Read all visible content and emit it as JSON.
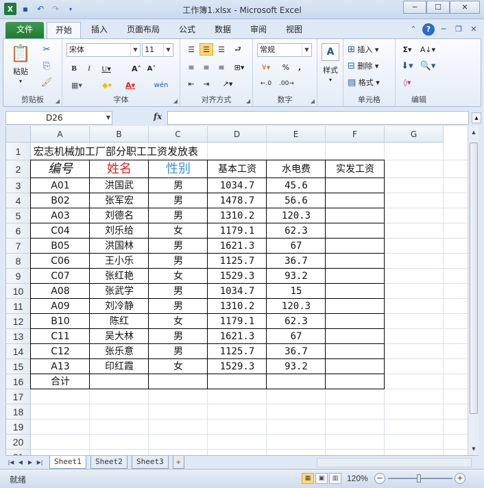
{
  "window": {
    "title": "工作簿1.xlsx  -  Microsoft Excel",
    "min_label": "─",
    "max_label": "☐",
    "close_label": "✕"
  },
  "ribbon_tabs": [
    "文件",
    "开始",
    "插入",
    "页面布局",
    "公式",
    "数据",
    "审阅",
    "视图"
  ],
  "ribbon": {
    "clipboard": {
      "label": "剪贴板",
      "paste": "粘贴"
    },
    "font": {
      "label": "字体",
      "font_name": "宋体",
      "font_size": "11"
    },
    "alignment": {
      "label": "对齐方式"
    },
    "number": {
      "label": "数字",
      "format": "常规"
    },
    "styles": {
      "label": "样式"
    },
    "cells": {
      "label": "单元格",
      "insert": "插入",
      "delete": "删除",
      "format": "格式"
    },
    "editing": {
      "label": "编辑"
    }
  },
  "formula_bar": {
    "name_box": "D26",
    "fx": "fx",
    "value": ""
  },
  "columns": [
    "A",
    "B",
    "C",
    "D",
    "E",
    "F",
    "G"
  ],
  "rows": [
    "1",
    "2",
    "3",
    "4",
    "5",
    "6",
    "7",
    "8",
    "9",
    "10",
    "11",
    "12",
    "13",
    "14",
    "15",
    "16",
    "17",
    "18",
    "19",
    "20",
    "21"
  ],
  "sheet": {
    "title": "宏志机械加工厂部分职工工资发放表",
    "headers": [
      "编号",
      "姓名",
      "性别",
      "基本工资",
      "水电费",
      "实发工资"
    ],
    "header_colors": [
      "#111111",
      "#e0201a",
      "#3b8fd8",
      "#111111",
      "#111111",
      "#111111"
    ],
    "records": [
      [
        "A01",
        "洪国武",
        "男",
        "1034.7",
        "45.6"
      ],
      [
        "B02",
        "张军宏",
        "男",
        "1478.7",
        "56.6"
      ],
      [
        "A03",
        "刘德名",
        "男",
        "1310.2",
        "120.3"
      ],
      [
        "C04",
        "刘乐给",
        "女",
        "1179.1",
        "62.3"
      ],
      [
        "B05",
        "洪国林",
        "男",
        "1621.3",
        "67"
      ],
      [
        "C06",
        "王小乐",
        "男",
        "1125.7",
        "36.7"
      ],
      [
        "C07",
        "张红艳",
        "女",
        "1529.3",
        "93.2"
      ],
      [
        "A08",
        "张武学",
        "男",
        "1034.7",
        "15"
      ],
      [
        "A09",
        "刘冷静",
        "男",
        "1310.2",
        "120.3"
      ],
      [
        "B10",
        "陈红",
        "女",
        "1179.1",
        "62.3"
      ],
      [
        "C11",
        "吴大林",
        "男",
        "1621.3",
        "67"
      ],
      [
        "C12",
        "张乐意",
        "男",
        "1125.7",
        "36.7"
      ],
      [
        "A13",
        "印红霞",
        "女",
        "1529.3",
        "93.2"
      ]
    ],
    "total_label": "合计"
  },
  "sheet_tabs": [
    "Sheet1",
    "Sheet2",
    "Sheet3"
  ],
  "status": {
    "ready": "就绪",
    "zoom": "120%"
  },
  "icons": {
    "save": "save-icon",
    "undo": "undo-icon",
    "redo": "redo-icon",
    "help": "help-icon",
    "sum": "sum-icon",
    "sort": "sort-filter-icon"
  }
}
